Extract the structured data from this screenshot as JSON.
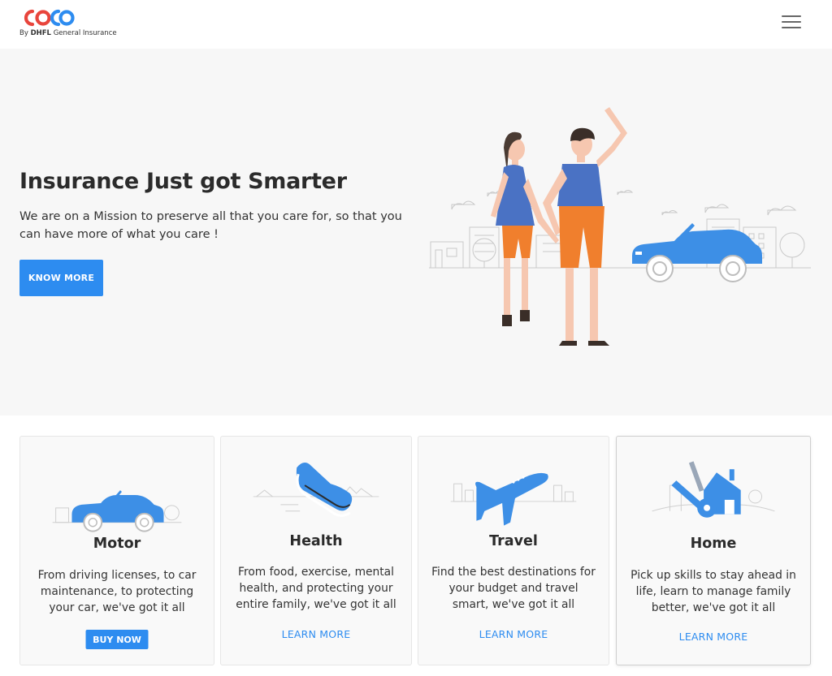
{
  "header": {
    "logo_text": "COCO",
    "logo_by": "By",
    "logo_brand": "DHFL",
    "logo_company": "General Insurance",
    "menu_icon": "hamburger-menu-icon"
  },
  "hero": {
    "title": "Insurance Just got Smarter",
    "subtitle": "We are on a Mission to preserve all that you care for, so that you can have more of what you care !",
    "cta_label": "KNOW MORE"
  },
  "cards": [
    {
      "title": "Motor",
      "text": "From driving licenses, to car maintenance, to protecting your car, we've got it all",
      "action": "BUY NOW",
      "icon": "car-icon"
    },
    {
      "title": "Health",
      "text": "From food, exercise, mental health, and protecting your entire family, we've got it all",
      "action": "LEARN MORE",
      "icon": "sneaker-icon"
    },
    {
      "title": "Travel",
      "text": "Find the best destinations for your budget and travel smart, we've got it all",
      "action": "LEARN MORE",
      "icon": "airplane-icon"
    },
    {
      "title": "Home",
      "text": "Pick up skills to stay ahead in life, learn to manage family better, we've got it all",
      "action": "LEARN MORE",
      "icon": "house-key-icon"
    }
  ],
  "colors": {
    "accent": "#2d8cf0",
    "logo_red": "#e8453c",
    "logo_blue": "#2d8cf0",
    "hero_bg": "#f7f7f7",
    "orange": "#f07f2d",
    "shirt_blue": "#4a72c4"
  }
}
